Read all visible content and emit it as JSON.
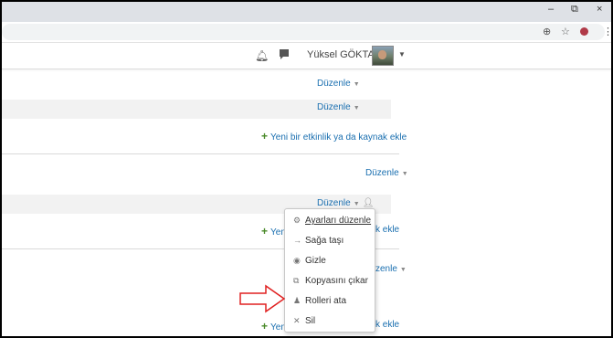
{
  "window": {
    "minimize_glyph": "–",
    "restore_glyph": "⧉",
    "close_glyph": "×"
  },
  "toolbar": {
    "zoom_icon": "zoom-icon",
    "star_icon": "star-icon",
    "extension_icon": "extension-icon",
    "menu_glyph": "⋮"
  },
  "navbar": {
    "user_name": "Yüksel GÖKTAŞ",
    "bell_icon": "bell-icon",
    "message_icon": "message-icon"
  },
  "section1": {
    "edit_label": "Düzenle",
    "activity_edit_label": "Düzenle",
    "add_label": "Yeni bir etkinlik ya da kaynak ekle"
  },
  "section2": {
    "edit_label": "Düzenle",
    "activity_edit_label": "Düzenle",
    "add_partial_left": "Yen",
    "add_partial_right": "k ekle"
  },
  "section3": {
    "edit_partial": "zenle",
    "add_partial_left": "Yen",
    "add_partial_right": "k ekle"
  },
  "dropdown": {
    "items": [
      {
        "label": "Ayarları düzenle",
        "icon": "gear-icon",
        "glyph": "⚙"
      },
      {
        "label": "Sağa taşı",
        "icon": "arrow-right-icon",
        "glyph": "→"
      },
      {
        "label": "Gizle",
        "icon": "eye-icon",
        "glyph": "◉"
      },
      {
        "label": "Kopyasını çıkar",
        "icon": "copy-icon",
        "glyph": "⧉"
      },
      {
        "label": "Rolleri ata",
        "icon": "user-role-icon",
        "glyph": "♟"
      },
      {
        "label": "Sil",
        "icon": "delete-icon",
        "glyph": "✕"
      }
    ]
  },
  "annotation": {
    "arrow_color": "#e02020"
  },
  "colors": {
    "link": "#1a6fb0",
    "plus": "#4a8a2a"
  }
}
